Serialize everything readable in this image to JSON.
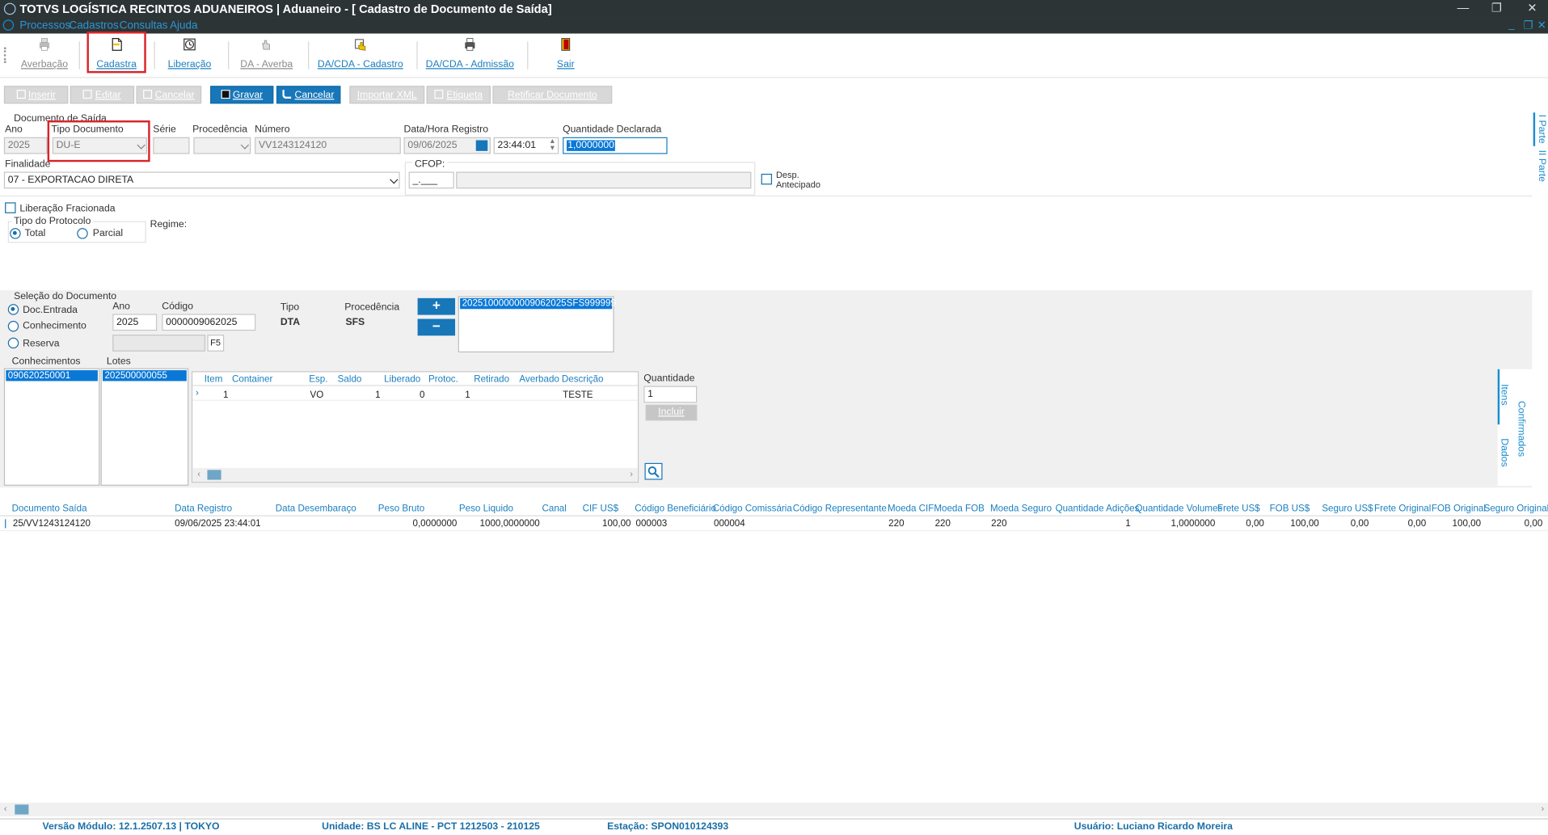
{
  "window": {
    "title": "TOTVS LOGÍSTICA RECINTOS ADUANEIROS | Aduaneiro - [ Cadastro de Documento de Saída]"
  },
  "menu": [
    "Processos",
    "Cadastros",
    "Consultas",
    "Ajuda"
  ],
  "toolbar": [
    {
      "label": "Averbação",
      "icon": "printer-icon",
      "enabled": false
    },
    {
      "label": "Cadastra",
      "icon": "document-icon",
      "enabled": true,
      "highlighted": true
    },
    {
      "label": "Liberação",
      "icon": "clock-icon",
      "enabled": true
    },
    {
      "label": "DA - Averba",
      "icon": "hand-icon",
      "enabled": false
    },
    {
      "label": "DA/CDA - Cadastro",
      "icon": "hand-document-icon",
      "enabled": true
    },
    {
      "label": "DA/CDA - Admissão",
      "icon": "printer-doc-icon",
      "enabled": true
    },
    {
      "label": "Sair",
      "icon": "exit-door-icon",
      "enabled": true
    }
  ],
  "actions": {
    "inserir": "Inserir",
    "editar": "Editar",
    "cancelar_dis": "Cancelar",
    "gravar": "Gravar",
    "cancelar": "Cancelar",
    "importar_xml": "Importar XML",
    "etiqueta": "Etiqueta",
    "retificar": "Retificar Documento"
  },
  "form": {
    "section": "Documento de Saída",
    "ano_label": "Ano",
    "ano": "2025",
    "tipo_label": "Tipo Documento",
    "tipo": "DU-E",
    "serie_label": "Série",
    "serie": "",
    "procedencia_label": "Procedência",
    "procedencia": "",
    "numero_label": "Número",
    "numero": "VV1243124120",
    "data_label": "Data/Hora Registro",
    "data": "09/06/2025",
    "hora": "23:44:01",
    "qtd_label": "Quantidade Declarada",
    "qtd": "1,0000000",
    "finalidade_label": "Finalidade",
    "finalidade": "07 - EXPORTACAO DIRETA",
    "cfop_label": "CFOP:",
    "cfop": "_.___",
    "desp_label1": "Desp.",
    "desp_label2": "Antecipado",
    "lib_frac": "Liberação Fracionada",
    "tipo_protocolo": "Tipo do Protocolo",
    "total": "Total",
    "parcial": "Parcial",
    "regime": "Regime:",
    "side_tab1": "I Parte",
    "side_tab2": "II Parte"
  },
  "selecao": {
    "title": "Seleção do Documento",
    "doc_entrada": "Doc.Entrada",
    "conhecimento": "Conhecimento",
    "reserva": "Reserva",
    "ano_label": "Ano",
    "ano": "2025",
    "codigo_label": "Código",
    "codigo": "0000009062025",
    "f5": "F5",
    "tipo_label": "Tipo",
    "tipo": "DTA",
    "proc_label": "Procedência",
    "proc": "SFS",
    "plus": "+",
    "minus": "−",
    "selected_doc": "20251000000009062025SFS999999",
    "conhecimentos_label": "Conhecimentos",
    "conhecimento_item": "090620250001",
    "lotes_label": "Lotes",
    "lote_item": "202500000055",
    "quantidade_label": "Quantidade",
    "quantidade": "1",
    "incluir": "Incluir",
    "tab_itens": "Itens",
    "tab_confirmados": "Confirmados",
    "tab_dados": "Dados"
  },
  "items_grid": {
    "headers": [
      "Item",
      "Container",
      "Esp.",
      "Saldo",
      "Liberado",
      "Protoc.",
      "Retirado",
      "Averbado",
      "Descrição"
    ],
    "rows": [
      [
        "1",
        "",
        "VO",
        "1",
        "0",
        "1",
        "",
        "",
        "TESTE"
      ]
    ]
  },
  "main_grid": {
    "headers": [
      "Documento Saída",
      "Data Registro",
      "Data  Desembaraço",
      "Peso Bruto",
      "Peso Liquido",
      "Canal",
      "CIF US$",
      "Código Beneficiário",
      "Código Comissária",
      "Código Representante",
      "Moeda CIF",
      "Moeda FOB",
      "Moeda Seguro",
      "Quantidade Adições",
      "Quantidade Volumes",
      "Frete US$",
      "FOB US$",
      "Seguro US$",
      "Frete Original",
      "FOB Original",
      "Seguro Original"
    ],
    "rows": [
      [
        "25/VV1243124120",
        "09/06/2025 23:44:01",
        "",
        "0,0000000",
        "1000,0000000",
        "",
        "100,00",
        "000003",
        "000004",
        "",
        "220",
        "220",
        "220",
        "1",
        "1,0000000",
        "0,00",
        "100,00",
        "0,00",
        "0,00",
        "100,00",
        "0,00"
      ]
    ]
  },
  "status": {
    "versao": "Versão Módulo:  12.1.2507.13  |  TOKYO",
    "unidade": "Unidade: BS LC ALINE - PCT 1212503 - 210125",
    "estacao": "Estação: SPON010124393",
    "usuario": "Usuário: Luciano Ricardo Moreira"
  },
  "colors": {
    "accent": "#1777b9",
    "highlight": "#d9242a",
    "selection": "#0a78d7",
    "titlebar": "#2d3436"
  }
}
